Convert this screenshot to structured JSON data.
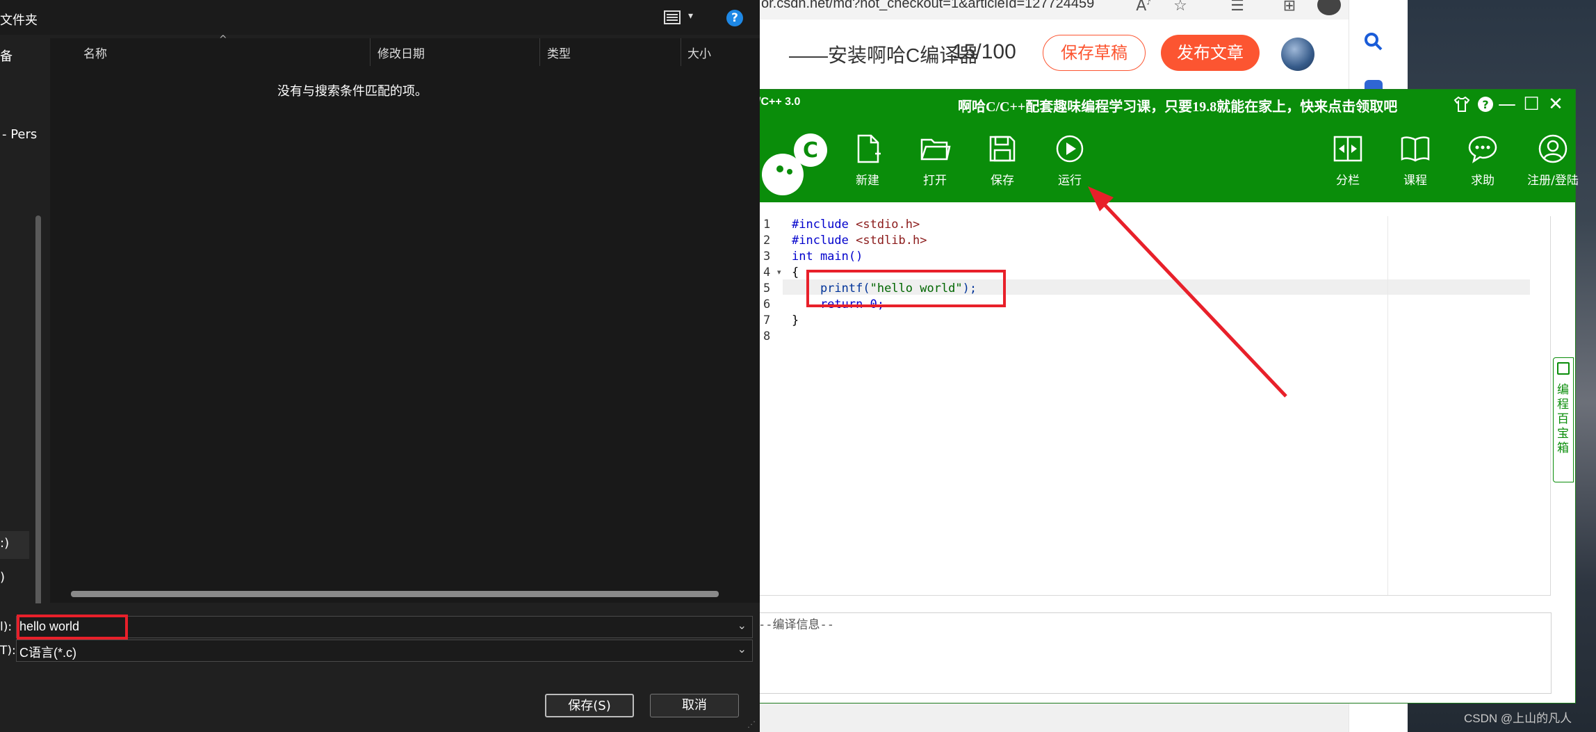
{
  "browser": {
    "address": "or.csdn.net/md?not_checkout=1&articleId=127724459",
    "article_title": "——安装啊哈C编译器",
    "word_count": "15/100",
    "save_draft": "保存草稿",
    "publish": "发布文章"
  },
  "ide": {
    "app_title": "/C++ 3.0",
    "promo": "啊哈C/C++配套趣味编程学习课，只要19.8就能在家上，快来点击领取吧",
    "tools": [
      {
        "label": "新建",
        "icon": "new-file-icon"
      },
      {
        "label": "打开",
        "icon": "open-folder-icon"
      },
      {
        "label": "保存",
        "icon": "save-icon"
      },
      {
        "label": "运行",
        "icon": "run-icon"
      },
      {
        "label": "分栏",
        "icon": "split-view-icon"
      },
      {
        "label": "课程",
        "icon": "book-icon"
      },
      {
        "label": "求助",
        "icon": "help-chat-icon"
      },
      {
        "label": "注册/登陆",
        "icon": "register-login-icon"
      }
    ],
    "code_lines": [
      {
        "n": "1",
        "text": "#include <stdio.h>"
      },
      {
        "n": "2",
        "text": "#include <stdlib.h>"
      },
      {
        "n": "3",
        "text": "int main()"
      },
      {
        "n": "4",
        "text": "{"
      },
      {
        "n": "5",
        "text": "    printf(\"hello world\");"
      },
      {
        "n": "6",
        "text": "    return 0;"
      },
      {
        "n": "7",
        "text": "}"
      },
      {
        "n": "8",
        "text": ""
      }
    ],
    "compile_label": "--编译信息--",
    "side_tab": "编程百宝箱"
  },
  "dialog": {
    "breadcrumb": "文件夹",
    "nav_items": [
      "备",
      "- Pers",
      ":)",
      ")"
    ],
    "columns": [
      "名称",
      "修改日期",
      "类型",
      "大小"
    ],
    "empty_message": "没有与搜索条件匹配的项。",
    "filename_label": "l):",
    "filename_value": "hello world",
    "filetype_label": "T):",
    "filetype_value": "C语言(*.c)",
    "save_button": "保存(S)",
    "cancel_button": "取消"
  },
  "watermark": "CSDN @上山的凡人",
  "colors": {
    "ide_green": "#0a8d0a",
    "annotation_red": "#e8202a",
    "csdn_orange": "#fc5531",
    "dialog_bg": "#202020"
  }
}
